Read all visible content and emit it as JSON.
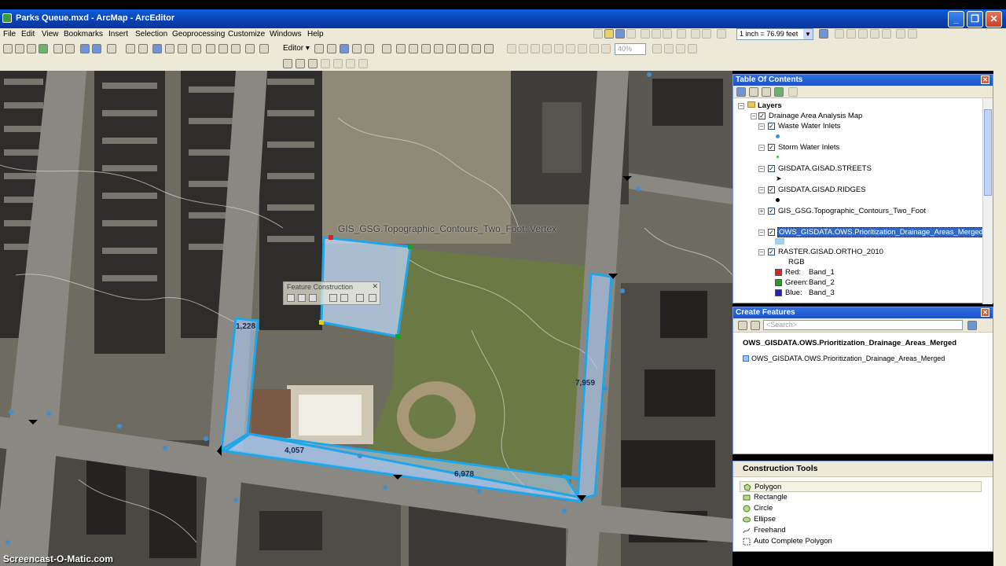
{
  "window": {
    "title": "Parks Queue.mxd - ArcMap - ArcEditor",
    "min_glyph": "_",
    "max_glyph": "❐",
    "close_glyph": "✕"
  },
  "menu": {
    "items": [
      "File",
      "Edit",
      "View",
      "Bookmarks",
      "Insert",
      "Selection",
      "Geoprocessing",
      "Customize",
      "Windows",
      "Help"
    ]
  },
  "toolbar": {
    "scale": "1 inch = 76.99 feet",
    "editor_label": "Editor ▾",
    "zoom_pct": "40%"
  },
  "map": {
    "vertex_tooltip": "GIS_GSG.Topographic_Contours_Two_Foot: Vertex",
    "feature_construction_title": "Feature Construction",
    "feature_construction_close": "✕",
    "segment_labels": [
      "1,228",
      "4,057",
      "6,978",
      "7,959"
    ]
  },
  "toc": {
    "title": "Table Of Contents",
    "layers_label": "Layers",
    "group_label": "Drainage Area Analysis Map",
    "items": [
      {
        "label": "Waste Water Inlets",
        "symbol_color": "#3f8fd0"
      },
      {
        "label": "Storm Water Inlets",
        "symbol_color": "#2fb84a"
      },
      {
        "label": "GISDATA.GISAD.STREETS",
        "symbol_color": "#000000"
      },
      {
        "label": "GISDATA.GISAD.RIDGES",
        "symbol_color": "#000000"
      },
      {
        "label": "GIS_GSG.Topographic_Contours_Two_Foot",
        "symbol_color": "#888888"
      },
      {
        "label": "OWS_GISDATA.OWS.Prioritization_Drainage_Areas_Merged",
        "symbol_color": "#9fd0f0"
      },
      {
        "label": "RASTER.GISAD.ORTHO_2010",
        "symbol_color": ""
      }
    ],
    "rgb_label": "RGB",
    "bands": [
      {
        "channel": "Red:",
        "band": "Band_1",
        "color": "#e02020"
      },
      {
        "channel": "Green:",
        "band": "Band_2",
        "color": "#20a020"
      },
      {
        "channel": "Blue:",
        "band": "Band_3",
        "color": "#2020d0"
      }
    ]
  },
  "create_features": {
    "title": "Create Features",
    "search_placeholder": "<Search>",
    "group": "OWS_GISDATA.OWS.Prioritization_Drainage_Areas_Merged",
    "template": "OWS_GISDATA.OWS.Prioritization_Drainage_Areas_Merged"
  },
  "construction_tools": {
    "title": "Construction Tools",
    "tools": [
      "Polygon",
      "Rectangle",
      "Circle",
      "Ellipse",
      "Freehand",
      "Auto Complete Polygon"
    ],
    "active": "Polygon"
  },
  "watermark": "Screencast-O-Matic.com"
}
